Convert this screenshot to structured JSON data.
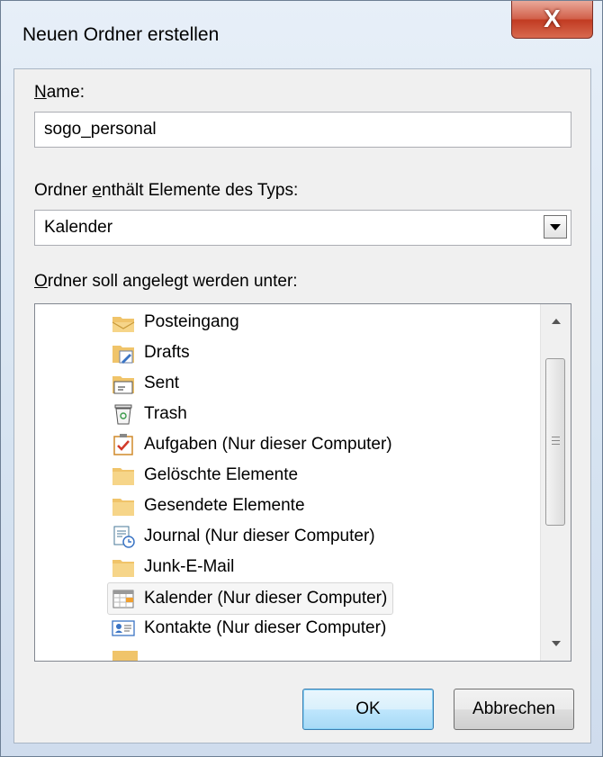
{
  "dialog": {
    "title": "Neuen Ordner erstellen",
    "close_glyph": "X"
  },
  "name_field": {
    "label_underlined": "N",
    "label_rest": "ame:",
    "value": "sogo_personal"
  },
  "type_field": {
    "label_before": "Ordner ",
    "label_underlined": "e",
    "label_after": "nthält Elemente des Typs:",
    "selected": "Kalender"
  },
  "location_field": {
    "label_underlined": "O",
    "label_rest": "rdner soll angelegt werden unter:"
  },
  "folders": [
    {
      "label": "Posteingang",
      "icon": "inbox-folder-icon"
    },
    {
      "label": "Drafts",
      "icon": "drafts-folder-icon"
    },
    {
      "label": "Sent",
      "icon": "sent-folder-icon"
    },
    {
      "label": "Trash",
      "icon": "trash-icon"
    },
    {
      "label": "Aufgaben (Nur dieser Computer)",
      "icon": "tasks-icon"
    },
    {
      "label": "Gelöschte Elemente",
      "icon": "folder-icon"
    },
    {
      "label": "Gesendete Elemente",
      "icon": "folder-icon"
    },
    {
      "label": "Journal (Nur dieser Computer)",
      "icon": "journal-icon"
    },
    {
      "label": "Junk-E-Mail",
      "icon": "folder-icon"
    },
    {
      "label": "Kalender (Nur dieser Computer)",
      "icon": "calendar-icon",
      "selected": true
    },
    {
      "label": "Kontakte (Nur dieser Computer)",
      "icon": "contacts-icon"
    }
  ],
  "buttons": {
    "ok": "OK",
    "cancel": "Abbrechen"
  },
  "colors": {
    "folder": "#f0c46a",
    "close_button": "#c8452d",
    "default_button_border": "#3c7fb1"
  }
}
